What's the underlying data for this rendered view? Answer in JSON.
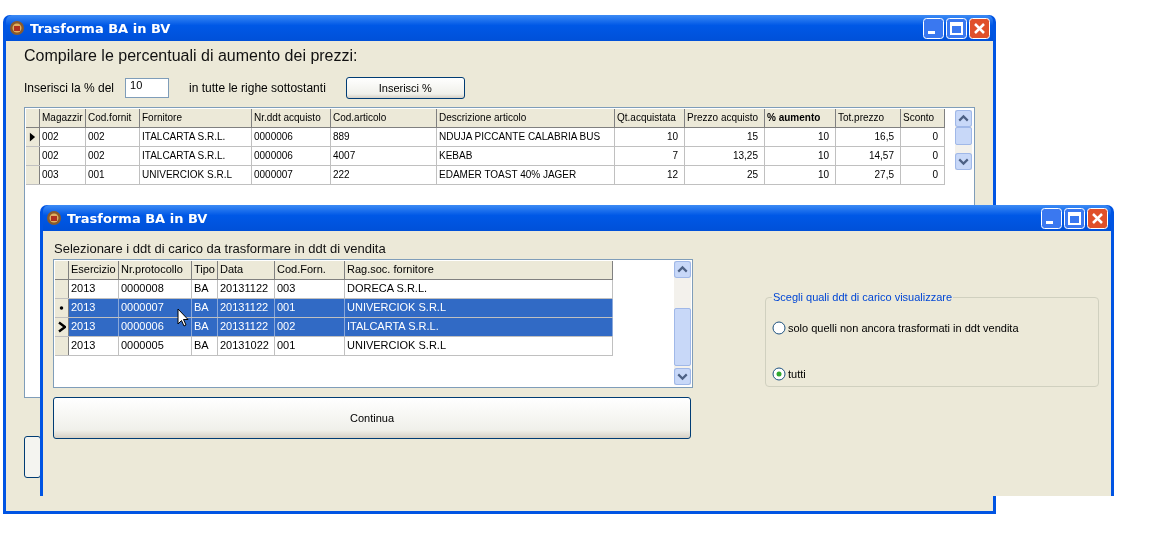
{
  "back_window": {
    "title": "Trasforma BA in BV",
    "heading": "Compilare le percentuali di aumento dei prezzi:",
    "percent_label": "Inserisci la % del",
    "percent_value": "10",
    "percent_suffix": "in tutte le righe sottostanti",
    "insert_button": "Inserisci %",
    "table": {
      "columns": [
        {
          "label": "Magazzir",
          "kind": "text",
          "emphasized": false
        },
        {
          "label": "Cod.fornit",
          "kind": "text",
          "emphasized": false
        },
        {
          "label": "Fornitore",
          "kind": "text",
          "emphasized": false
        },
        {
          "label": "Nr.ddt acquisto",
          "kind": "text",
          "emphasized": false
        },
        {
          "label": "Cod.articolo",
          "kind": "text",
          "emphasized": false
        },
        {
          "label": "Descrizione articolo",
          "kind": "text",
          "emphasized": false
        },
        {
          "label": "Qt.acquistata",
          "kind": "number",
          "emphasized": false
        },
        {
          "label": "Prezzo acquisto",
          "kind": "number",
          "emphasized": false
        },
        {
          "label": "% aumento",
          "kind": "number",
          "emphasized": true
        },
        {
          "label": "Tot.prezzo",
          "kind": "number",
          "emphasized": false
        },
        {
          "label": "Sconto",
          "kind": "number",
          "emphasized": false
        }
      ],
      "rows": [
        {
          "current": true,
          "cells": [
            "002",
            "002",
            "ITALCARTA S.R.L.",
            "0000006",
            "889",
            "NDUJA PICCANTE CALABRIA BUS",
            "10",
            "15",
            "10",
            "16,5",
            "0"
          ]
        },
        {
          "current": false,
          "cells": [
            "002",
            "002",
            "ITALCARTA S.R.L.",
            "0000006",
            "4007",
            "KEBAB",
            "7",
            "13,25",
            "10",
            "14,57",
            "0"
          ]
        },
        {
          "current": false,
          "cells": [
            "003",
            "001",
            "UNIVERCIOK S.R.L",
            "0000007",
            "222",
            "EDAMER TOAST 40% JAGER",
            "12",
            "25",
            "10",
            "27,5",
            "0"
          ]
        }
      ]
    }
  },
  "front_window": {
    "title": "Trasforma BA in BV",
    "heading": "Selezionare i ddt di carico da trasformare in ddt di vendita",
    "table": {
      "columns": [
        "Esercizio",
        "Nr.protocollo",
        "Tipo",
        "Data",
        "Cod.Forn.",
        "Rag.soc. fornitore"
      ],
      "rows": [
        {
          "current": false,
          "marked": false,
          "selected": false,
          "cells": [
            "2013",
            "0000008",
            "BA",
            "20131122",
            "003",
            "DORECA S.R.L."
          ]
        },
        {
          "current": false,
          "marked": true,
          "selected": true,
          "cells": [
            "2013",
            "0000007",
            "BA",
            "20131122",
            "001",
            "UNIVERCIOK S.R.L"
          ]
        },
        {
          "current": true,
          "marked": false,
          "selected": true,
          "cells": [
            "2013",
            "0000006",
            "BA",
            "20131122",
            "002",
            "ITALCARTA S.R.L."
          ]
        },
        {
          "current": false,
          "marked": false,
          "selected": false,
          "cells": [
            "2013",
            "0000005",
            "BA",
            "20131022",
            "001",
            "UNIVERCIOK S.R.L"
          ]
        }
      ]
    },
    "continue_button": "Continua",
    "filter_group": {
      "title": "Scegli quali ddt di carico visualizzare",
      "options": [
        {
          "label": "solo quelli non ancora trasformati in ddt vendita",
          "selected": false
        },
        {
          "label": "tutti",
          "selected": true
        }
      ]
    }
  }
}
